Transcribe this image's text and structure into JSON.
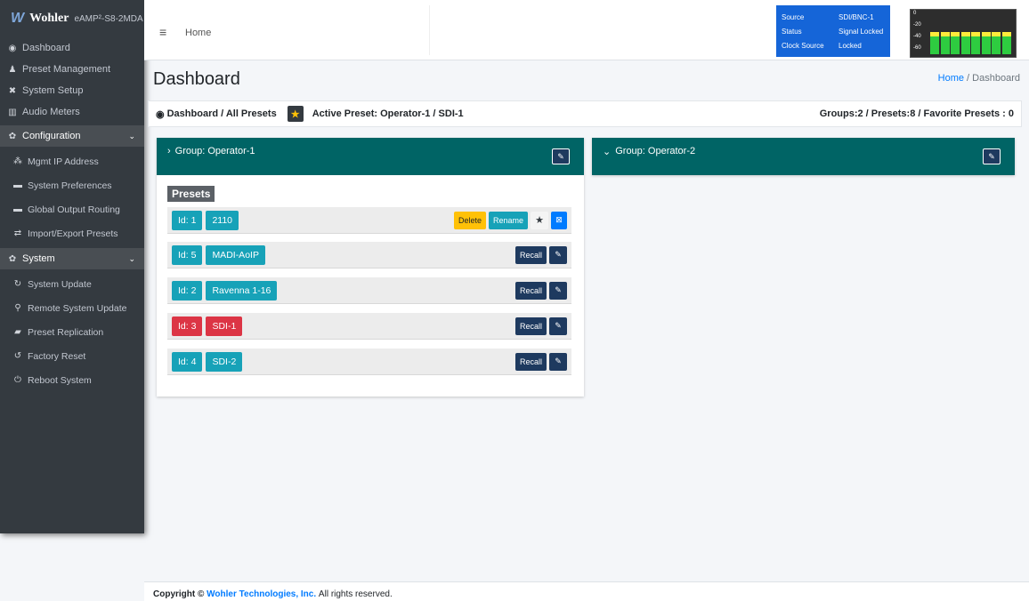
{
  "app": {
    "brand": "Wohler",
    "model": "eAMP²-S8-2MDA"
  },
  "sidebar": {
    "items": [
      {
        "label": "Dashboard",
        "icon": "tachometer-icon"
      },
      {
        "label": "Preset Management",
        "icon": "user-cog-icon"
      },
      {
        "label": "System Setup",
        "icon": "tools-icon"
      },
      {
        "label": "Audio Meters",
        "icon": "chart-icon"
      }
    ],
    "configuration": {
      "label": "Configuration",
      "items": [
        {
          "label": "Mgmt IP Address",
          "icon": "network-icon"
        },
        {
          "label": "System Preferences",
          "icon": "keyboard-icon"
        },
        {
          "label": "Global Output Routing",
          "icon": "keyboard-icon"
        },
        {
          "label": "Import/Export Presets",
          "icon": "exchange-icon"
        }
      ]
    },
    "system": {
      "label": "System",
      "items": [
        {
          "label": "System Update",
          "icon": "sync-icon"
        },
        {
          "label": "Remote System Update",
          "icon": "satellite-icon"
        },
        {
          "label": "Preset Replication",
          "icon": "database-icon"
        },
        {
          "label": "Factory Reset",
          "icon": "undo-icon"
        },
        {
          "label": "Reboot System",
          "icon": "power-icon"
        }
      ]
    }
  },
  "topbar": {
    "home": "Home",
    "status": [
      {
        "key": "Source",
        "value": "SDI/BNC-1"
      },
      {
        "key": "Status",
        "value": "Signal Locked"
      },
      {
        "key": "Clock Source",
        "value": "Locked"
      }
    ],
    "meter_labels": [
      "0",
      "-20",
      "-40",
      "-60"
    ],
    "meter_levels": [
      0.62,
      0.62,
      0.62,
      0.62,
      0.62,
      0.62,
      0.62,
      0.62
    ],
    "colors": {
      "status_bg": "#1565d8",
      "meter_green": "#2ecc40",
      "meter_yellow": "#ffeb3b"
    }
  },
  "header": {
    "title": "Dashboard",
    "breadcrumb_home": "Home",
    "breadcrumb_sep": "/",
    "breadcrumb_current": "Dashboard"
  },
  "infobar": {
    "path": "Dashboard / All Presets",
    "active_preset": "Active Preset: Operator-1 / SDI-1",
    "counts": "Groups:2 / Presets:8 / Favorite Presets : 0"
  },
  "groups": [
    {
      "name": "Group: Operator-1",
      "expanded": true,
      "presets_label": "Presets",
      "presets": [
        {
          "id": "Id: 1",
          "name": "2110",
          "actions": [
            "Delete",
            "Rename"
          ]
        },
        {
          "id": "Id: 5",
          "name": "MADI-AoIP",
          "actions": [
            "Recall"
          ]
        },
        {
          "id": "Id: 2",
          "name": "Ravenna 1-16",
          "actions": [
            "Recall"
          ]
        },
        {
          "id": "Id: 3",
          "name": "SDI-1",
          "actions": [
            "Recall"
          ],
          "active": true
        },
        {
          "id": "Id: 4",
          "name": "SDI-2",
          "actions": [
            "Recall"
          ]
        }
      ]
    },
    {
      "name": "Group: Operator-2",
      "expanded": false
    }
  ],
  "footer": {
    "prefix": "Copyright ©",
    "company": "Wohler Technologies, Inc.",
    "suffix": "All rights reserved."
  }
}
